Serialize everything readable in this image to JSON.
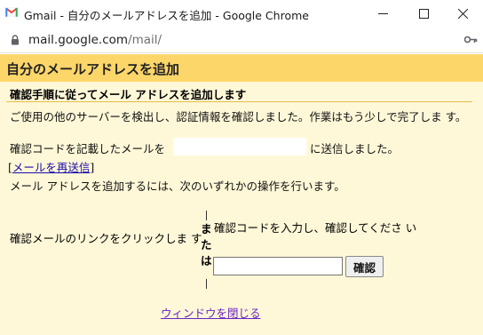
{
  "window": {
    "title": "Gmail - 自分のメールアドレスを追加 - Google Chrome"
  },
  "address_bar": {
    "url_host": "mail.google.com",
    "url_path": "/mail/"
  },
  "dialog": {
    "title": "自分のメールアドレスを追加",
    "section_title": "確認手順に従ってメール アドレスを追加します",
    "paragraph_1": "ご使用の他のサーバーを検出し、認証情報を確認しました。作業はもう少しで完了しま す。",
    "paragraph_2_prefix": "確認コードを記載したメールを",
    "paragraph_2_suffix": "に送信しました。",
    "resend_link": "メールを再送信",
    "resend_open_bracket": "[",
    "resend_close_bracket": "]",
    "paragraph_3": "メール アドレスを追加するには、次のいずれかの操作を行います。",
    "option_link": "確認メールのリンクをクリックしま す",
    "or_label": "ま た は",
    "option_code": "確認コードを入力し、確認してくださ い",
    "code_input_value": "",
    "verify_button": "確認",
    "close_link": "ウィンドウを閉じる"
  },
  "colors": {
    "header_bg": "#fdd66a",
    "dialog_bg": "#fff8d8",
    "link": "#1a0dab",
    "visited_link": "#6a24c4",
    "gmail_red": "#ea4335"
  }
}
